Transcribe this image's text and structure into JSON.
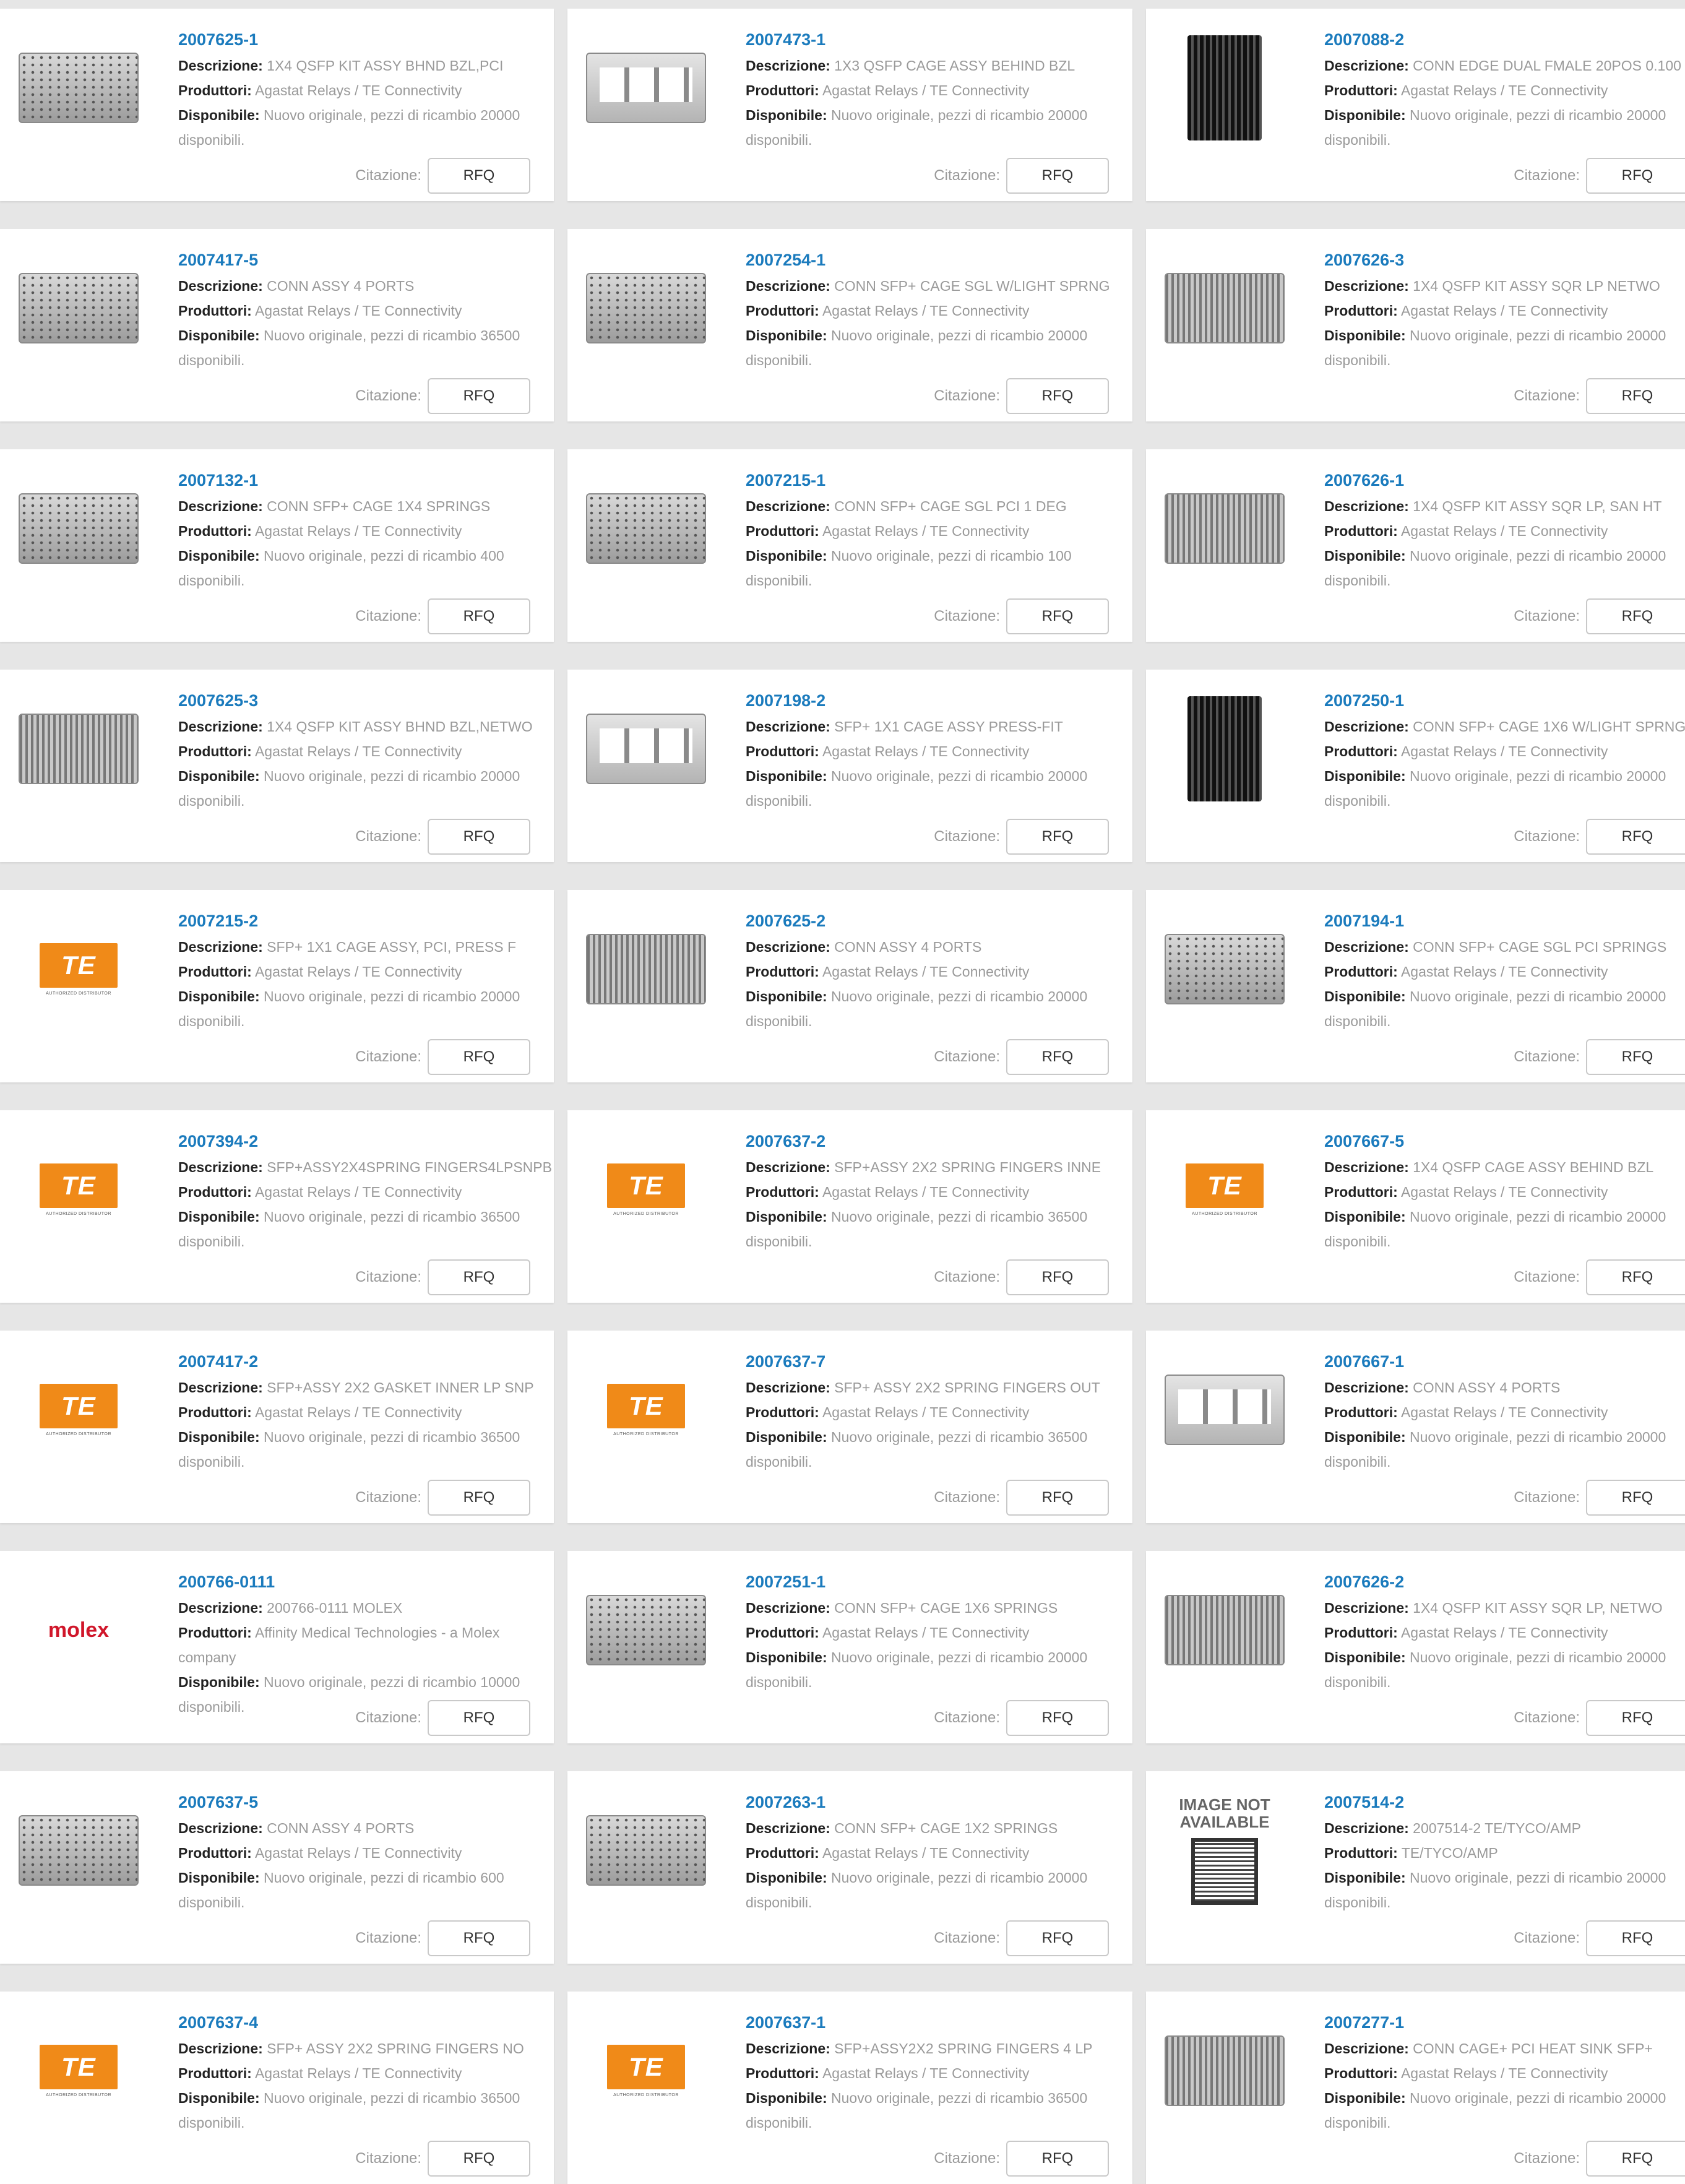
{
  "labels": {
    "description": "Descrizione:",
    "producer": "Produttori:",
    "available": "Disponibile:",
    "quote": "Citazione:",
    "rfq": "RFQ"
  },
  "products": [
    {
      "pn": "2007625-1",
      "desc": "1X4 QSFP KIT ASSY BHND BZL,PCI",
      "producer": "Agastat Relays / TE Connectivity",
      "avail": "Nuovo originale, pezzi di ricambio 20000 disponibili.",
      "image": "photo-qsfp-cage"
    },
    {
      "pn": "2007473-1",
      "desc": "1X3 QSFP CAGE ASSY BEHIND BZL",
      "producer": "Agastat Relays / TE Connectivity",
      "avail": "Nuovo originale, pezzi di ricambio 20000 disponibili.",
      "image": "photo-open-cage"
    },
    {
      "pn": "2007088-2",
      "desc": "CONN EDGE DUAL FMALE 20POS 0.100",
      "producer": "Agastat Relays / TE Connectivity",
      "avail": "Nuovo originale, pezzi di ricambio 20000 disponibili.",
      "image": "photo-edge-connector"
    },
    {
      "pn": "2007417-5",
      "desc": "CONN ASSY 4 PORTS",
      "producer": "Agastat Relays / TE Connectivity",
      "avail": "Nuovo originale, pezzi di ricambio 36500 disponibili.",
      "image": "photo-cage"
    },
    {
      "pn": "2007254-1",
      "desc": "CONN SFP+ CAGE SGL W/LIGHT SPRNG",
      "producer": "Agastat Relays / TE Connectivity",
      "avail": "Nuovo originale, pezzi di ricambio 20000 disponibili.",
      "image": "photo-cage"
    },
    {
      "pn": "2007626-3",
      "desc": "1X4 QSFP KIT ASSY SQR LP NETWO",
      "producer": "Agastat Relays / TE Connectivity",
      "avail": "Nuovo originale, pezzi di ricambio 20000 disponibili.",
      "image": "photo-heat-cage"
    },
    {
      "pn": "2007132-1",
      "desc": "CONN SFP+ CAGE 1X4 SPRINGS",
      "producer": "Agastat Relays / TE Connectivity",
      "avail": "Nuovo originale, pezzi di ricambio 400 disponibili.",
      "image": "photo-cage"
    },
    {
      "pn": "2007215-1",
      "desc": "CONN SFP+ CAGE SGL PCI 1 DEG",
      "producer": "Agastat Relays / TE Connectivity",
      "avail": "Nuovo originale, pezzi di ricambio 100 disponibili.",
      "image": "photo-cage"
    },
    {
      "pn": "2007626-1",
      "desc": "1X4 QSFP KIT ASSY SQR LP, SAN HT",
      "producer": "Agastat Relays / TE Connectivity",
      "avail": "Nuovo originale, pezzi di ricambio 20000 disponibili.",
      "image": "photo-heat-cage"
    },
    {
      "pn": "2007625-3",
      "desc": "1X4 QSFP KIT ASSY BHND BZL,NETWO",
      "producer": "Agastat Relays / TE Connectivity",
      "avail": "Nuovo originale, pezzi di ricambio 20000 disponibili.",
      "image": "photo-heat-cage"
    },
    {
      "pn": "2007198-2",
      "desc": "SFP+ 1X1 CAGE ASSY PRESS-FIT",
      "producer": "Agastat Relays / TE Connectivity",
      "avail": "Nuovo originale, pezzi di ricambio 20000 disponibili.",
      "image": "photo-open-cage"
    },
    {
      "pn": "2007250-1",
      "desc": "CONN SFP+ CAGE 1X6 W/LIGHT SPRNG",
      "producer": "Agastat Relays / TE Connectivity",
      "avail": "Nuovo originale, pezzi di ricambio 20000 disponibili.",
      "image": "photo-edge-connector"
    },
    {
      "pn": "2007215-2",
      "desc": "SFP+ 1X1 CAGE ASSY, PCI, PRESS F",
      "producer": "Agastat Relays / TE Connectivity",
      "avail": "Nuovo originale, pezzi di ricambio 20000 disponibili.",
      "image": "te-logo"
    },
    {
      "pn": "2007625-2",
      "desc": "CONN ASSY 4 PORTS",
      "producer": "Agastat Relays / TE Connectivity",
      "avail": "Nuovo originale, pezzi di ricambio 20000 disponibili.",
      "image": "photo-heat-cage"
    },
    {
      "pn": "2007194-1",
      "desc": "CONN SFP+ CAGE SGL PCI SPRINGS",
      "producer": "Agastat Relays / TE Connectivity",
      "avail": "Nuovo originale, pezzi di ricambio 20000 disponibili.",
      "image": "photo-cage"
    },
    {
      "pn": "2007394-2",
      "desc": "SFP+ASSY2X4SPRING FINGERS4LPSNPB",
      "producer": "Agastat Relays / TE Connectivity",
      "avail": "Nuovo originale, pezzi di ricambio 36500 disponibili.",
      "image": "te-logo"
    },
    {
      "pn": "2007637-2",
      "desc": "SFP+ASSY 2X2 SPRING FINGERS INNE",
      "producer": "Agastat Relays / TE Connectivity",
      "avail": "Nuovo originale, pezzi di ricambio 36500 disponibili.",
      "image": "te-logo"
    },
    {
      "pn": "2007667-5",
      "desc": "1X4 QSFP CAGE ASSY BEHIND BZL",
      "producer": "Agastat Relays / TE Connectivity",
      "avail": "Nuovo originale, pezzi di ricambio 20000 disponibili.",
      "image": "te-logo"
    },
    {
      "pn": "2007417-2",
      "desc": "SFP+ASSY 2X2 GASKET INNER LP SNP",
      "producer": "Agastat Relays / TE Connectivity",
      "avail": "Nuovo originale, pezzi di ricambio 36500 disponibili.",
      "image": "te-logo"
    },
    {
      "pn": "2007637-7",
      "desc": "SFP+ ASSY 2X2 SPRING FINGERS OUT",
      "producer": "Agastat Relays / TE Connectivity",
      "avail": "Nuovo originale, pezzi di ricambio 36500 disponibili.",
      "image": "te-logo"
    },
    {
      "pn": "2007667-1",
      "desc": "CONN ASSY 4 PORTS",
      "producer": "Agastat Relays / TE Connectivity",
      "avail": "Nuovo originale, pezzi di ricambio 20000 disponibili.",
      "image": "photo-open-cage"
    },
    {
      "pn": "200766-0111",
      "desc": "200766-0111 MOLEX",
      "producer": "Affinity Medical Technologies - a Molex company",
      "avail": "Nuovo originale, pezzi di ricambio 10000 disponibili.",
      "image": "molex-logo"
    },
    {
      "pn": "2007251-1",
      "desc": "CONN SFP+ CAGE 1X6 SPRINGS",
      "producer": "Agastat Relays / TE Connectivity",
      "avail": "Nuovo originale, pezzi di ricambio 20000 disponibili.",
      "image": "photo-cage"
    },
    {
      "pn": "2007626-2",
      "desc": "1X4 QSFP KIT ASSY SQR LP, NETWO",
      "producer": "Agastat Relays / TE Connectivity",
      "avail": "Nuovo originale, pezzi di ricambio 20000 disponibili.",
      "image": "photo-heat-cage"
    },
    {
      "pn": "2007637-5",
      "desc": "CONN ASSY 4 PORTS",
      "producer": "Agastat Relays / TE Connectivity",
      "avail": "Nuovo originale, pezzi di ricambio 600 disponibili.",
      "image": "photo-cage"
    },
    {
      "pn": "2007263-1",
      "desc": "CONN SFP+ CAGE 1X2 SPRINGS",
      "producer": "Agastat Relays / TE Connectivity",
      "avail": "Nuovo originale, pezzi di ricambio 20000 disponibili.",
      "image": "photo-cage"
    },
    {
      "pn": "2007514-2",
      "desc": "2007514-2 TE/TYCO/AMP",
      "producer": "TE/TYCO/AMP",
      "avail": "Nuovo originale, pezzi di ricambio 20000 disponibili.",
      "image": "image-not-available"
    },
    {
      "pn": "2007637-4",
      "desc": "SFP+ ASSY 2X2 SPRING FINGERS NO",
      "producer": "Agastat Relays / TE Connectivity",
      "avail": "Nuovo originale, pezzi di ricambio 36500 disponibili.",
      "image": "te-logo"
    },
    {
      "pn": "2007637-1",
      "desc": "SFP+ASSY2X2 SPRING FINGERS 4 LP",
      "producer": "Agastat Relays / TE Connectivity",
      "avail": "Nuovo originale, pezzi di ricambio 36500 disponibili.",
      "image": "te-logo"
    },
    {
      "pn": "2007277-1",
      "desc": "CONN CAGE+ PCI HEAT SINK SFP+",
      "producer": "Agastat Relays / TE Connectivity",
      "avail": "Nuovo originale, pezzi di ricambio 20000 disponibili.",
      "image": "photo-heat-cage"
    }
  ],
  "logo_text": {
    "te": "TE",
    "te_sub": "AUTHORIZED DISTRIBUTOR",
    "molex": "molex",
    "na_line1": "IMAGE NOT",
    "na_line2": "AVAILABLE"
  },
  "colors": {
    "link": "#1b7bbd",
    "te_orange": "#f08a18",
    "molex_red": "#d0162a",
    "background": "#e6e6e6"
  }
}
